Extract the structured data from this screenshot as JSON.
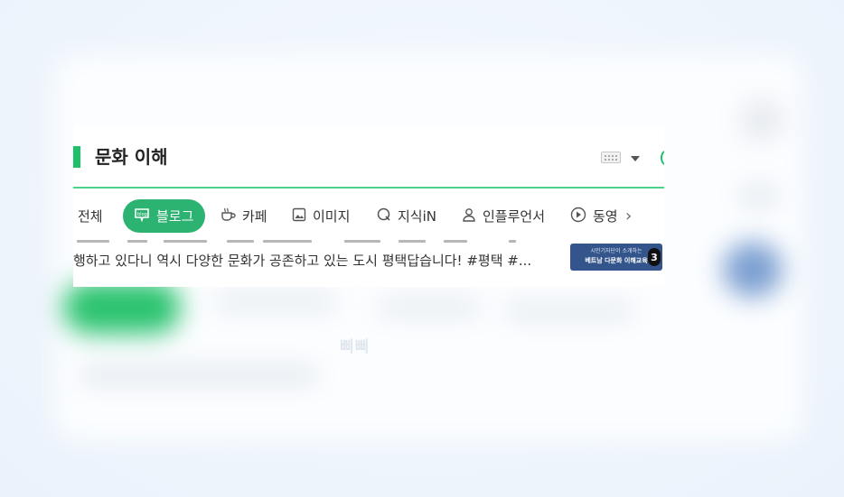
{
  "search": {
    "query": "문화 이해"
  },
  "tabs": [
    {
      "label": "전체"
    },
    {
      "label": "블로그"
    },
    {
      "label": "카페"
    },
    {
      "label": "이미지"
    },
    {
      "label": "지식iN"
    },
    {
      "label": "인플루언서"
    },
    {
      "label": "동영"
    }
  ],
  "result": {
    "snippet": "행하고 있다니 역시 다양한 문화가 공존하고 있는 도시 평택답습니다! #평택 #...",
    "thumbnail_caption": "시민기자단이 소개하는",
    "thumbnail_title": "베트남 다문화 이해교육",
    "thumbnail_count": "3"
  },
  "watermark": "삐삐",
  "colors": {
    "accent": "#2db371",
    "query_bar": "#1ec06a",
    "thumbnail": "#33558b"
  },
  "icons": [
    "keyboard-icon",
    "dropdown-caret-icon",
    "blog-icon",
    "cafe-icon",
    "image-icon",
    "search-q-icon",
    "person-icon",
    "play-icon",
    "chevron-right-icon",
    "chevron-left-icon"
  ]
}
